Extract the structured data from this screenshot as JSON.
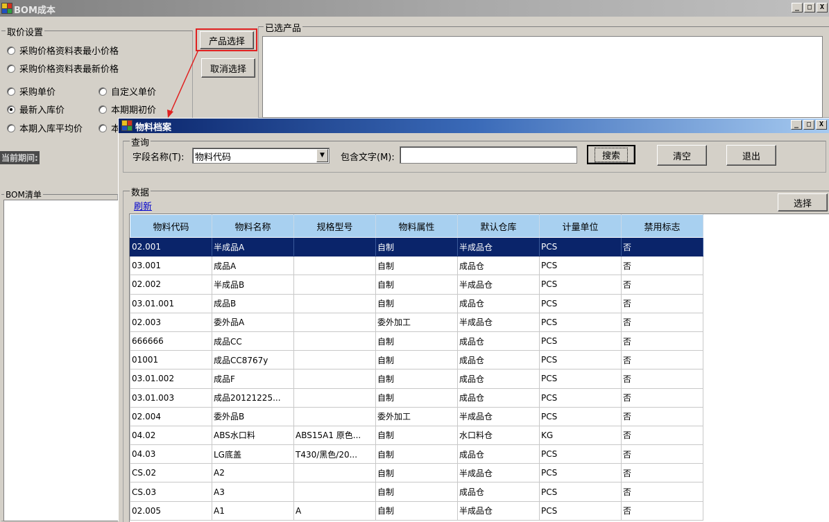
{
  "main_window": {
    "title": "BOM成本",
    "controls": {
      "minimize": "_",
      "maximize": "□",
      "close": "X"
    },
    "price_group": {
      "legend": "取价设置",
      "options": [
        {
          "label": "采购价格资料表最小价格",
          "checked": false
        },
        {
          "label": "采购价格资料表最新价格",
          "checked": false
        },
        {
          "label": "采购单价",
          "checked": false
        },
        {
          "label": "自定义单价",
          "checked": false
        },
        {
          "label": "最新入库价",
          "checked": true
        },
        {
          "label": "本期期初价",
          "checked": false
        },
        {
          "label": "本期入库平均价",
          "checked": false
        },
        {
          "label": "本",
          "checked": false
        }
      ]
    },
    "period_label": "当前期间:",
    "bom_list_legend": "BOM清单",
    "product_select_button": "产品选择",
    "cancel_select_button": "取消选择",
    "selected_products_legend": "已选产品"
  },
  "dialog": {
    "title": "物料档案",
    "controls": {
      "minimize": "_",
      "maximize": "□",
      "close": "X"
    },
    "query": {
      "legend": "查询",
      "field_label": "字段名称(T):",
      "field_value": "物料代码",
      "contains_label": "包含文字(M):",
      "contains_value": "",
      "search_button": "搜索",
      "clear_button": "清空",
      "exit_button": "退出"
    },
    "data": {
      "legend": "数据",
      "refresh_link": "刷新",
      "select_button": "选择",
      "columns": [
        "物料代码",
        "物料名称",
        "规格型号",
        "物料属性",
        "默认仓库",
        "计量单位",
        "禁用标志"
      ],
      "rows": [
        [
          "02.001",
          "半成品A",
          "",
          "自制",
          "半成品仓",
          "PCS",
          "否"
        ],
        [
          "03.001",
          "成品A",
          "",
          "自制",
          "成品仓",
          "PCS",
          "否"
        ],
        [
          "02.002",
          "半成品B",
          "",
          "自制",
          "半成品仓",
          "PCS",
          "否"
        ],
        [
          "03.01.001",
          "成品B",
          "",
          "自制",
          "成品仓",
          "PCS",
          "否"
        ],
        [
          "02.003",
          "委外品A",
          "",
          "委外加工",
          "半成品仓",
          "PCS",
          "否"
        ],
        [
          "666666",
          "成品CC",
          "",
          "自制",
          "成品仓",
          "PCS",
          "否"
        ],
        [
          "01001",
          "成品CC8767y",
          "",
          "自制",
          "成品仓",
          "PCS",
          "否"
        ],
        [
          "03.01.002",
          "成品F",
          "",
          "自制",
          "成品仓",
          "PCS",
          "否"
        ],
        [
          "03.01.003",
          "成品20121225...",
          "",
          "自制",
          "成品仓",
          "PCS",
          "否"
        ],
        [
          "02.004",
          "委外品B",
          "",
          "委外加工",
          "半成品仓",
          "PCS",
          "否"
        ],
        [
          "04.02",
          "ABS水口料",
          "ABS15A1 原色...",
          "自制",
          "水口料仓",
          "KG",
          "否"
        ],
        [
          "04.03",
          "LG底盖",
          "T430/黑色/20...",
          "自制",
          "成品仓",
          "PCS",
          "否"
        ],
        [
          "CS.02",
          "A2",
          "",
          "自制",
          "半成品仓",
          "PCS",
          "否"
        ],
        [
          "CS.03",
          "A3",
          "",
          "自制",
          "成品仓",
          "PCS",
          "否"
        ],
        [
          "02.005",
          "A1",
          "A",
          "自制",
          "半成品仓",
          "PCS",
          "否"
        ]
      ],
      "selected_row": 0
    }
  },
  "colors": {
    "dialog_title_gradient_start": "#0a246a",
    "selection": "#0a246a",
    "header_bg": "#a8d0f0",
    "highlight_outline": "#e02020",
    "window_bg": "#d4d0c8"
  }
}
